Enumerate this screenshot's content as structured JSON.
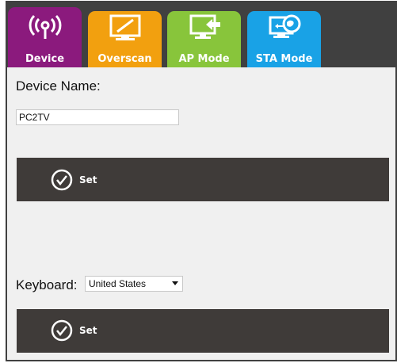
{
  "tabs": [
    {
      "label": "Device",
      "icon": "wifi-broadcast-icon",
      "color": "#8b1a7d"
    },
    {
      "label": "Overscan",
      "icon": "monitor-resize-icon",
      "color": "#f2a00f"
    },
    {
      "label": "AP Mode",
      "icon": "monitor-input-icon",
      "color": "#88c53b"
    },
    {
      "label": "STA Mode",
      "icon": "globe-connection-icon",
      "color": "#19a2e6"
    }
  ],
  "device": {
    "name_label": "Device Name:",
    "name_value": "PC2TV",
    "set_label": "Set"
  },
  "keyboard": {
    "label": "Keyboard:",
    "selected": "United States",
    "set_label": "Set"
  },
  "colors": {
    "tabbar_bg": "#404040",
    "set_bar_bg": "#3f3b39",
    "panel_bg": "#f0f0f0"
  }
}
